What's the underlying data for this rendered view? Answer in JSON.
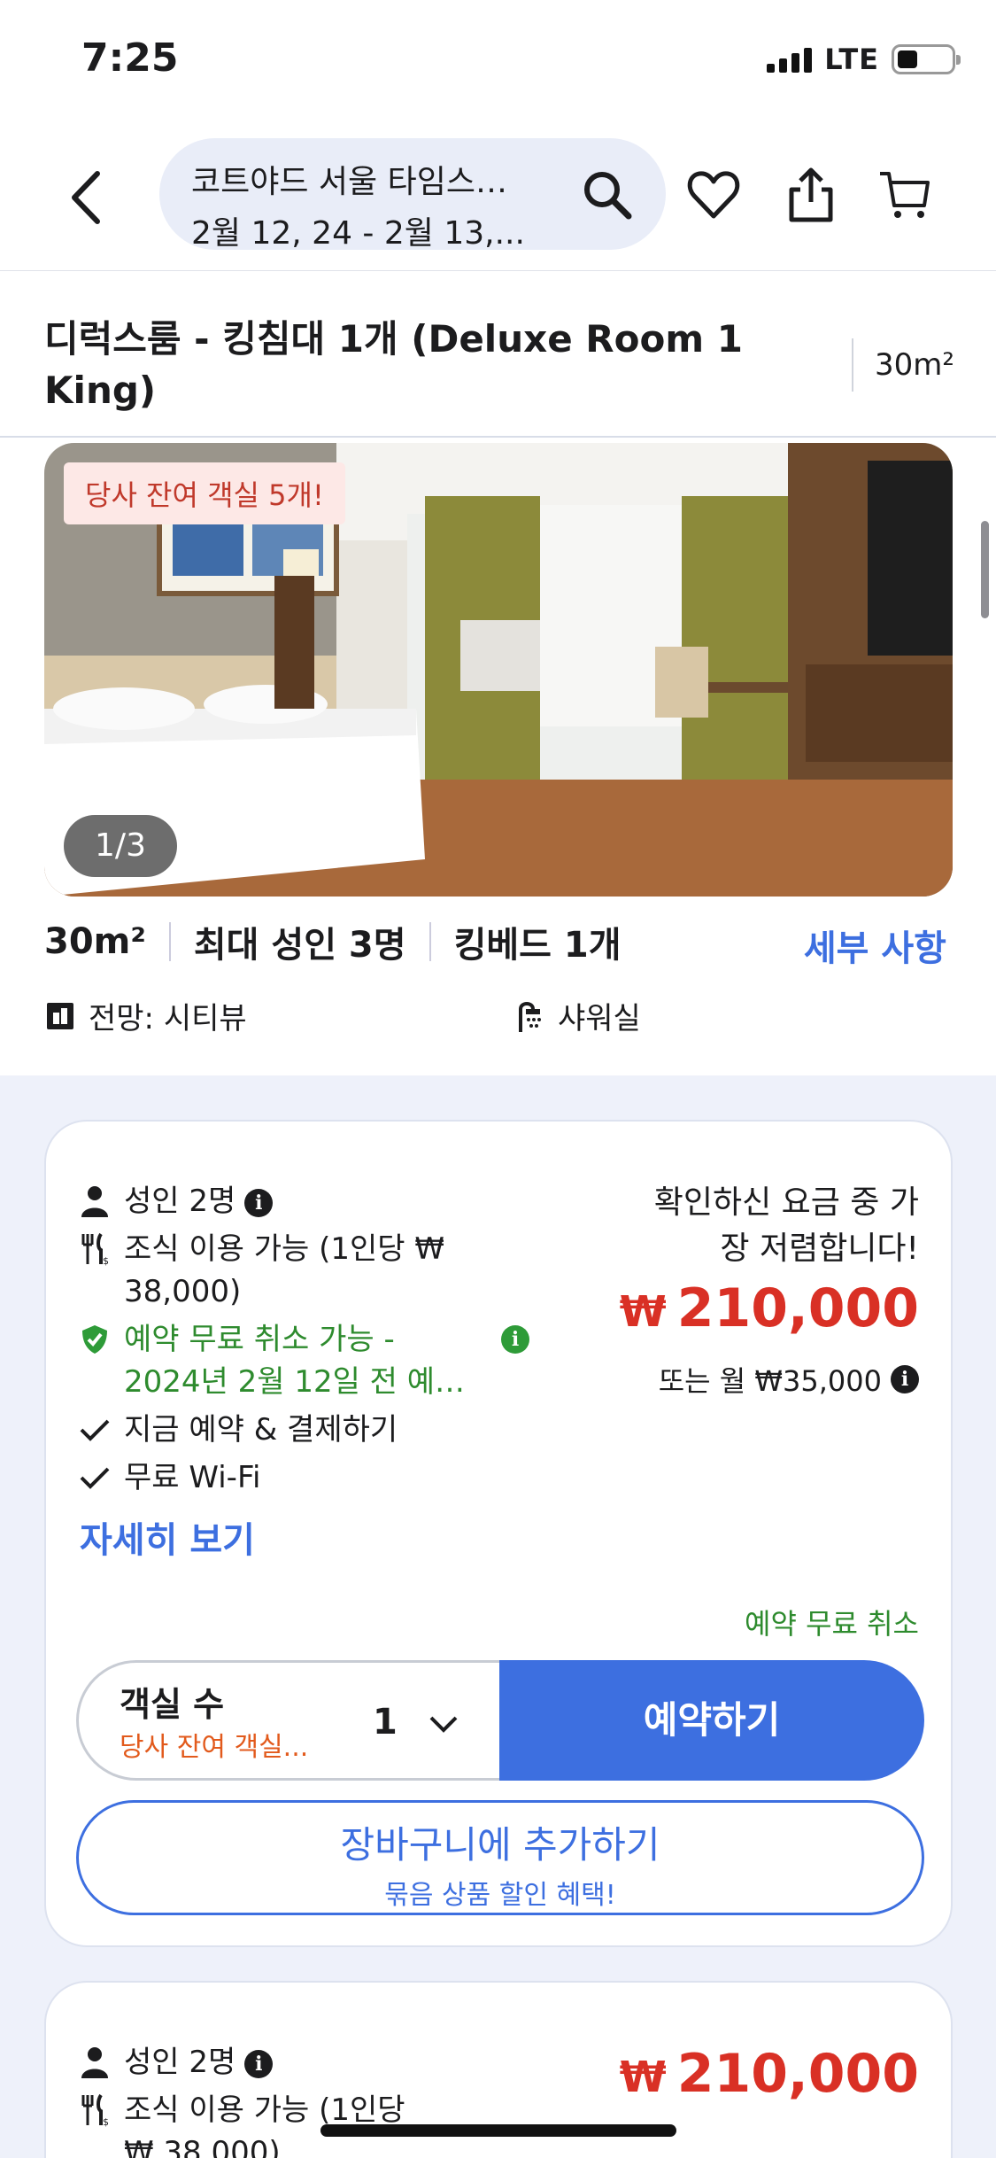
{
  "status_bar": {
    "time": "7:25",
    "network": "LTE"
  },
  "header": {
    "hotel_name": "코트야드 서울 타임스…",
    "dates": "2월 12, 24 - 2월 13,..."
  },
  "room": {
    "title": "디럭스룸 - 킹침대 1개 (Deluxe Room 1 King)",
    "size_label": "30m²",
    "availability_badge": "당사 잔여 객실 5개!",
    "photo_counter": "1/3",
    "specs": [
      "30m²",
      "최대 성인 3명",
      "킹베드 1개"
    ],
    "details_link": "세부 사항",
    "amenities": [
      {
        "icon": "city-view-icon",
        "label": "전망: 시티뷰"
      },
      {
        "icon": "shower-icon",
        "label": "샤워실"
      }
    ]
  },
  "rate_card_1": {
    "guests": "성인 2명",
    "breakfast": "조식 이용 가능 (1인당 ₩ 38,000)",
    "cancellation": "예약 무료 취소 가능 - 2024년 2월 12일 전 예…",
    "pay_now": "지금 예약 & 결제하기",
    "wifi": "무료 Wi-Fi",
    "more_link": "자세히 보기",
    "price_note": "확인하신 요금 중 가장 저렴합니다!",
    "currency_symbol": "₩",
    "price": "210,000",
    "monthly": "또는 월 ₩35,000",
    "free_cancel": "예약 무료 취소",
    "qty_label": "객실 수",
    "qty_sub": "당사 잔여 객실...",
    "qty_value": "1",
    "book_button": "예약하기",
    "cart_button": "장바구니에 추가하기",
    "cart_sub": "묶음 상품 할인 혜택!"
  },
  "rate_card_2": {
    "guests": "성인 2명",
    "breakfast": "조식 이용 가능 (1인당",
    "breakfast_price": "₩ 38,000)",
    "currency_symbol": "₩",
    "price": "210,000"
  },
  "colors": {
    "accent": "#3d6fe0",
    "price": "#d93025",
    "green": "#2e8b2e",
    "orange": "#e25a1c"
  }
}
